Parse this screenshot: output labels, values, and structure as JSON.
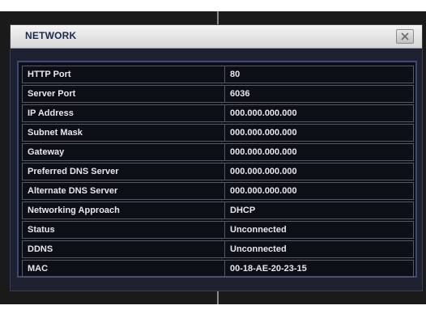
{
  "dialog": {
    "title": "NETWORK",
    "close_icon": "close-icon"
  },
  "rows": [
    {
      "label": "HTTP Port",
      "value": "80"
    },
    {
      "label": "Server Port",
      "value": "6036"
    },
    {
      "label": "IP Address",
      "value": "000.000.000.000"
    },
    {
      "label": "Subnet Mask",
      "value": "000.000.000.000"
    },
    {
      "label": "Gateway",
      "value": "000.000.000.000"
    },
    {
      "label": "Preferred DNS Server",
      "value": "000.000.000.000"
    },
    {
      "label": "Alternate DNS Server",
      "value": "000.000.000.000"
    },
    {
      "label": "Networking Approach",
      "value": "DHCP"
    },
    {
      "label": "Status",
      "value": "Unconnected"
    },
    {
      "label": "DDNS",
      "value": "Unconnected"
    },
    {
      "label": "MAC",
      "value": "00-18-AE-20-23-15"
    }
  ],
  "colors": {
    "panel": "#1e2230",
    "table_border": "#3d4a78",
    "text": "#e8e8ec",
    "title_text": "#1b2a4a"
  }
}
